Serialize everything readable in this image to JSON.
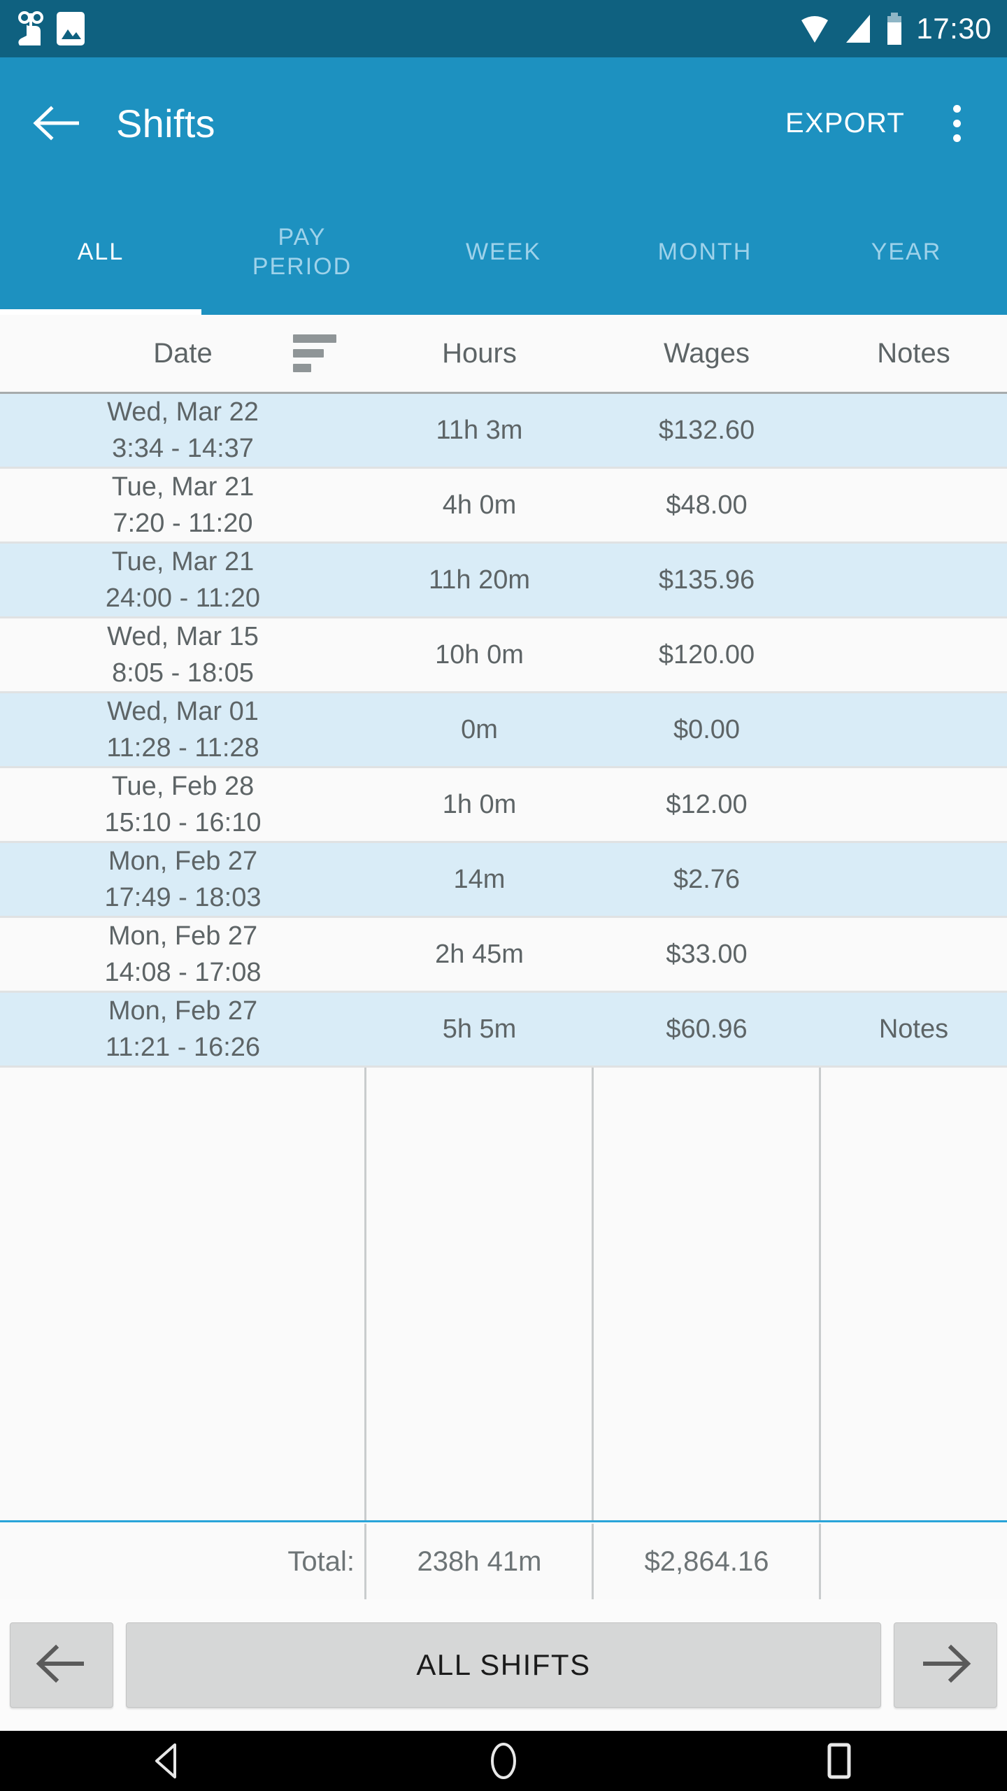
{
  "statusbar": {
    "time": "17:30",
    "icons": [
      "touch-record-icon",
      "screenshot-image-icon",
      "wifi-icon",
      "signal-icon",
      "battery-icon"
    ]
  },
  "appbar": {
    "back_label": "back-arrow-icon",
    "title": "Shifts",
    "export_label": "EXPORT",
    "overflow_label": "more-options-icon"
  },
  "tabs": {
    "active_index": 0,
    "items": [
      {
        "label": "ALL"
      },
      {
        "label": "PAY\nPERIOD"
      },
      {
        "label": "WEEK"
      },
      {
        "label": "MONTH"
      },
      {
        "label": "YEAR"
      }
    ]
  },
  "table": {
    "columns": [
      "Date",
      "Hours",
      "Wages",
      "Notes"
    ],
    "sort_icon": "sort-descending-icon",
    "rows": [
      {
        "date": "Wed, Mar 22",
        "range": "3:34 - 14:37",
        "hours": "11h 3m",
        "wages": "$132.60",
        "notes": ""
      },
      {
        "date": "Tue, Mar 21",
        "range": "7:20 - 11:20",
        "hours": "4h 0m",
        "wages": "$48.00",
        "notes": ""
      },
      {
        "date": "Tue, Mar 21",
        "range": "24:00 - 11:20",
        "hours": "11h 20m",
        "wages": "$135.96",
        "notes": ""
      },
      {
        "date": "Wed, Mar 15",
        "range": "8:05 - 18:05",
        "hours": "10h 0m",
        "wages": "$120.00",
        "notes": ""
      },
      {
        "date": "Wed, Mar 01",
        "range": "11:28 - 11:28",
        "hours": "0m",
        "wages": "$0.00",
        "notes": ""
      },
      {
        "date": "Tue, Feb 28",
        "range": "15:10 - 16:10",
        "hours": "1h 0m",
        "wages": "$12.00",
        "notes": ""
      },
      {
        "date": "Mon, Feb 27",
        "range": "17:49 - 18:03",
        "hours": "14m",
        "wages": "$2.76",
        "notes": ""
      },
      {
        "date": "Mon, Feb 27",
        "range": "14:08 - 17:08",
        "hours": "2h 45m",
        "wages": "$33.00",
        "notes": ""
      },
      {
        "date": "Mon, Feb 27",
        "range": "11:21 - 16:26",
        "hours": "5h 5m",
        "wages": "$60.96",
        "notes": "Notes"
      }
    ],
    "total": {
      "label": "Total:",
      "hours": "238h 41m",
      "wages": "$2,864.16",
      "notes": ""
    }
  },
  "buttonbar": {
    "prev_label": "arrow-left-icon",
    "center_label": "ALL SHIFTS",
    "next_label": "arrow-right-icon"
  },
  "navbar": {
    "back": "android-back-icon",
    "home": "android-home-icon",
    "recents": "android-recents-icon"
  },
  "colors": {
    "statusbar": "#0f6180",
    "appbar": "#1d91c0",
    "tab_inactive": "#9ed2ea",
    "row_alt": "#d9ecf7",
    "row_plain": "#fafafa",
    "divider": "#29a4d9",
    "text": "#5d6466"
  }
}
